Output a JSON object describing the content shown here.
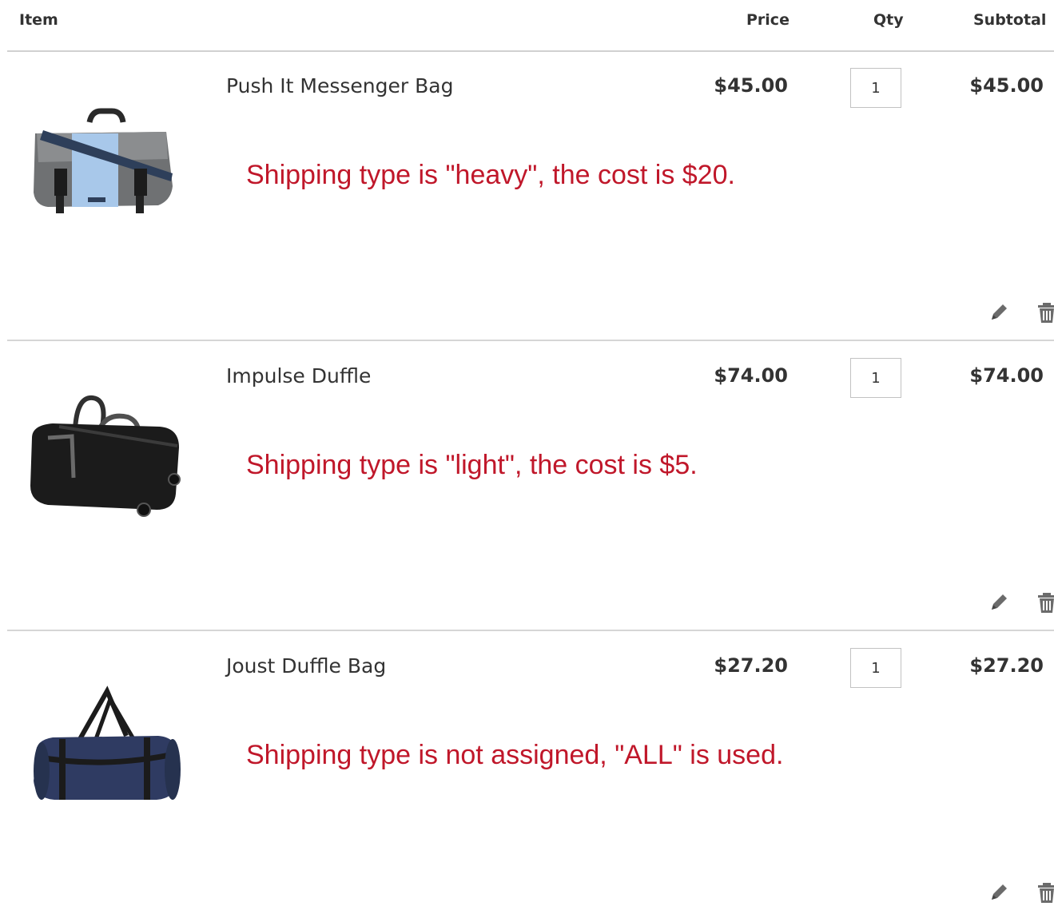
{
  "header": {
    "item": "Item",
    "price": "Price",
    "qty": "Qty",
    "subtotal": "Subtotal"
  },
  "items": [
    {
      "name": "Push It Messenger Bag",
      "price": "$45.00",
      "qty": "1",
      "subtotal": "$45.00",
      "note": "Shipping type is \"heavy\", the cost is $20.",
      "image": "messenger-bag-image"
    },
    {
      "name": "Impulse Duffle",
      "price": "$74.00",
      "qty": "1",
      "subtotal": "$74.00",
      "note": "Shipping type is \"light\", the cost is $5.",
      "image": "duffle-bag-image"
    },
    {
      "name": "Joust Duffle Bag",
      "price": "$27.20",
      "qty": "1",
      "subtotal": "$27.20",
      "note": "Shipping type is not assigned, \"ALL\" is used.",
      "image": "blue-duffle-bag-image"
    }
  ],
  "icons": {
    "edit": "pencil-icon",
    "delete": "trash-icon"
  },
  "colors": {
    "note": "#c0172a",
    "divider": "#d1d1d1"
  }
}
